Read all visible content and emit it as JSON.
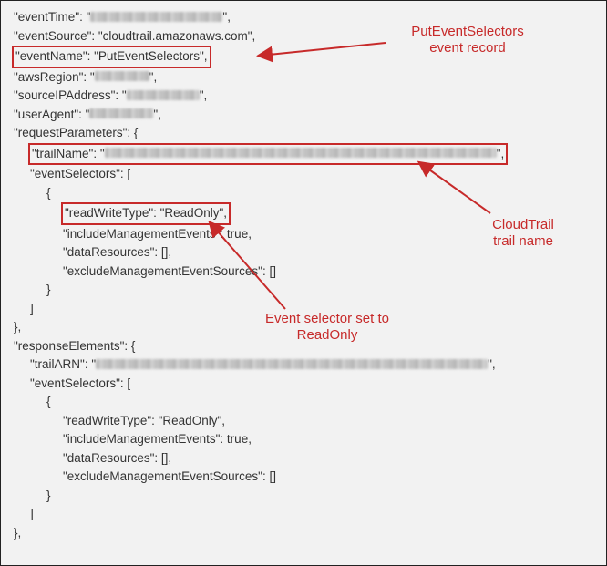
{
  "anno": {
    "a1_l1": "PutEventSelectors",
    "a1_l2": "event record",
    "a2_l1": "CloudTrail",
    "a2_l2": "trail name",
    "a3_l1": "Event selector set to",
    "a3_l2": "ReadOnly"
  },
  "lines": {
    "eventTime": "\"eventTime\": \"",
    "eventSource": "\"eventSource\": \"cloudtrail.amazonaws.com\",",
    "eventName": "\"eventName\": \"PutEventSelectors\",",
    "awsRegion": "\"awsRegion\": \"",
    "sourceIP": "\"sourceIPAddress\": \"",
    "userAgent": "\"userAgent\": \"",
    "requestParams": "\"requestParameters\": {",
    "trailName": "\"trailName\": \"",
    "eventSelectors": "\"eventSelectors\": [",
    "openBrace": "{",
    "readWriteType": "\"readWriteType\": \"ReadOnly\",",
    "includeMgmt": "\"includeManagementEvents\": true,",
    "dataResources": "\"dataResources\": [],",
    "excludeMgmt": "\"excludeManagementEventSources\": []",
    "closeBrace": "}",
    "closeBracket": "]",
    "closeBraceComma": "},",
    "responseElements": "\"responseElements\": {",
    "trailARN": "\"trailARN\": \"",
    "endQuoteComma": "\","
  }
}
